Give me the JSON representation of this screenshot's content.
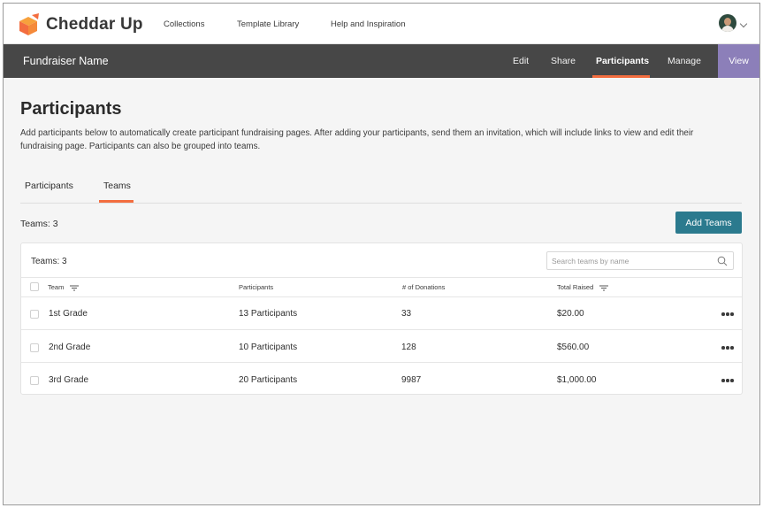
{
  "app": {
    "name": "Cheddar Up"
  },
  "topnav": {
    "items": [
      "Collections",
      "Template Library",
      "Help and Inspiration"
    ]
  },
  "collection_bar": {
    "title": "Fundraiser Name",
    "items": [
      "Edit",
      "Share",
      "Participants",
      "Manage"
    ],
    "active": "Participants",
    "view_label": "View"
  },
  "colors": {
    "accent": "#f36d3f",
    "primary_button": "#2b7a8e",
    "view_button": "#8c7fb9",
    "dark_bar": "#474747"
  },
  "page": {
    "title": "Participants",
    "intro": "Add participants below to automatically create participant fundraising pages. After adding your participants, send them an invitation, which will include links to view and edit their fundraising page. Participants can also be grouped into teams."
  },
  "tabs": [
    "Participants",
    "Teams"
  ],
  "active_tab": "Teams",
  "summary": {
    "teams_count": "Teams: 3",
    "add_button": "Add Teams"
  },
  "table": {
    "count_label": "Teams: 3",
    "search_placeholder": "Search teams by name",
    "columns": [
      "Team",
      "Participants",
      "# of Donations",
      "Total Raised"
    ],
    "rows": [
      {
        "team": "1st Grade",
        "participants": "13 Participants",
        "donations": "33",
        "raised": "$20.00"
      },
      {
        "team": "2nd Grade",
        "participants": "10 Participants",
        "donations": "128",
        "raised": "$560.00"
      },
      {
        "team": "3rd Grade",
        "participants": "20 Participants",
        "donations": "9987",
        "raised": "$1,000.00"
      }
    ]
  },
  "icons": {
    "logo": "cheddar-up-logo",
    "avatar": "user-avatar",
    "search": "search-icon",
    "sort": "sort-icon",
    "more": "more-options-icon"
  }
}
